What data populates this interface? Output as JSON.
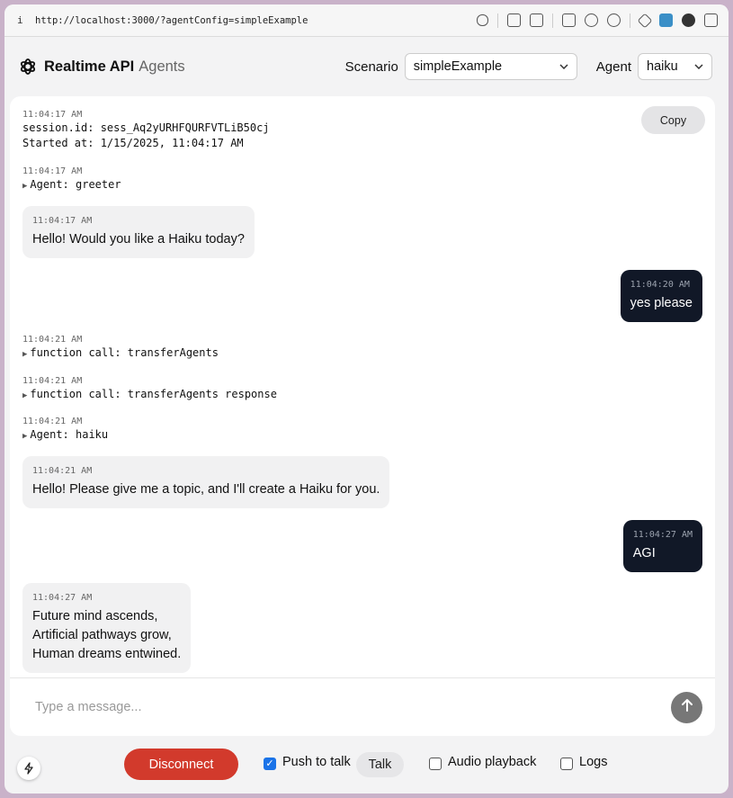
{
  "browser": {
    "info_glyph": "i",
    "url": "http://localhost:3000/?agentConfig=simpleExample",
    "toolbar_icons": [
      "link-icon",
      "download-icon",
      "camera-icon",
      "terminal-icon",
      "globe-icon",
      "crosshair-icon",
      "extension-icon",
      "blue-extension-icon",
      "profile-icon",
      "sidebar-icon"
    ]
  },
  "header": {
    "brand_bold": "Realtime API",
    "brand_light": "Agents",
    "scenario_label": "Scenario",
    "scenario_value": "simpleExample",
    "agent_label": "Agent",
    "agent_value": "haiku"
  },
  "transcript": {
    "copy_label": "Copy",
    "session": {
      "timestamp": "11:04:17 AM",
      "line1": "session.id: sess_Aq2yURHFQURFVTLiB50cj",
      "line2": "Started at: 1/15/2025, 11:04:17 AM"
    },
    "events": [
      {
        "timestamp": "11:04:17 AM",
        "text": "Agent: greeter"
      },
      {
        "timestamp": "11:04:21 AM",
        "text": "function call: transferAgents"
      },
      {
        "timestamp": "11:04:21 AM",
        "text": "function call: transferAgents response"
      },
      {
        "timestamp": "11:04:21 AM",
        "text": "Agent: haiku"
      }
    ],
    "messages": [
      {
        "role": "assistant",
        "timestamp": "11:04:17 AM",
        "lines": [
          "Hello! Would you like a Haiku today?"
        ]
      },
      {
        "role": "user",
        "timestamp": "11:04:20 AM",
        "lines": [
          "yes please"
        ]
      },
      {
        "role": "assistant",
        "timestamp": "11:04:21 AM",
        "lines": [
          "Hello! Please give me a topic, and I'll create a Haiku for you."
        ]
      },
      {
        "role": "user",
        "timestamp": "11:04:27 AM",
        "lines": [
          "AGI"
        ]
      },
      {
        "role": "assistant",
        "timestamp": "11:04:27 AM",
        "lines": [
          "Future mind ascends,",
          "Artificial pathways grow,",
          "Human dreams entwined."
        ]
      }
    ]
  },
  "composer": {
    "placeholder": "Type a message..."
  },
  "bottom_bar": {
    "disconnect_label": "Disconnect",
    "push_to_talk_label": "Push to talk",
    "push_to_talk_checked": true,
    "talk_label": "Talk",
    "audio_playback_label": "Audio playback",
    "audio_playback_checked": false,
    "logs_label": "Logs",
    "logs_checked": false
  },
  "colors": {
    "disconnect": "#d23a2c",
    "user_bubble": "#111827",
    "checkbox_checked": "#1a73e8"
  }
}
